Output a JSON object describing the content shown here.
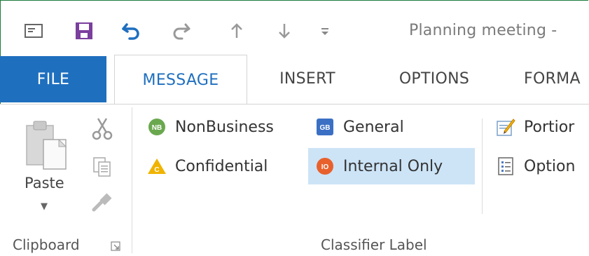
{
  "window": {
    "title": "Planning meeting -"
  },
  "quick_access": {
    "items": [
      {
        "icon": "new-message-icon"
      },
      {
        "icon": "save-icon"
      },
      {
        "icon": "undo-icon"
      },
      {
        "icon": "redo-icon"
      },
      {
        "icon": "previous-item-icon"
      },
      {
        "icon": "next-item-icon"
      },
      {
        "icon": "customize-toolbar-icon"
      }
    ]
  },
  "ribbon_tabs": {
    "file": "FILE",
    "message": "MESSAGE",
    "insert": "INSERT",
    "options": "OPTIONS",
    "format": "FORMA"
  },
  "clipboard": {
    "paste_label": "Paste",
    "group_label": "Clipboard"
  },
  "classifier": {
    "group_label": "Classifier Label",
    "labels": {
      "nonbusiness": "NonBusiness",
      "general": "General",
      "confidential": "Confidential",
      "internal_only": "Internal Only"
    },
    "badges": {
      "nonbusiness": "NB",
      "general": "GB",
      "confidential": "C",
      "internal_only": "IO"
    },
    "selected": "internal_only",
    "colors": {
      "nonbusiness": "#6aa84f",
      "general": "#3b6fc4",
      "confidential": "#f0b400",
      "internal_only": "#e8612c",
      "selected_bg": "#cde4f7"
    }
  },
  "portion": {
    "portion_label": "Portior",
    "options_label": "Option"
  },
  "colors": {
    "file_tab": "#1f6fbf",
    "accent": "#1f6fbf",
    "save_icon": "#7b3f9e"
  }
}
